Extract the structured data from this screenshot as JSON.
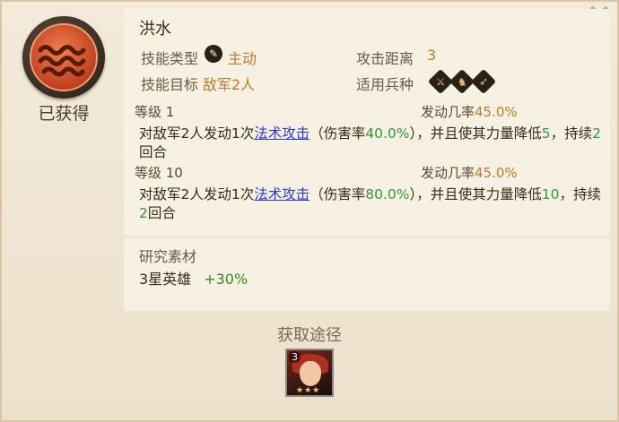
{
  "close_label": "×",
  "status": "已获得",
  "skill": {
    "name": "洪水",
    "type_label": "技能类型",
    "type_value": "主动",
    "target_label": "技能目标",
    "target_value": "敌军2人",
    "range_label": "攻击距离",
    "range_value": "3",
    "units_label": "适用兵种",
    "unit_icons": [
      "sword-icon",
      "horse-icon",
      "bow-icon"
    ]
  },
  "levels": [
    {
      "level_label": "等级 1",
      "rate_label": "发动几率",
      "rate_value": "45.0%",
      "d1": "对敌军2人发动1次",
      "link": "法术攻击",
      "d2": "（伤害率",
      "v1": "40.0%",
      "d3": "），并且使其力量降低",
      "v2": "5",
      "d4": "，持续",
      "v3": "2",
      "d5": "回合"
    },
    {
      "level_label": "等级 10",
      "rate_label": "发动几率",
      "rate_value": "45.0%",
      "d1": "对敌军2人发动1次",
      "link": "法术攻击",
      "d2": "（伤害率",
      "v1": "80.0%",
      "d3": "），并且使其力量降低",
      "v2": "10",
      "d4": "，持续",
      "v3": "2",
      "d5": "回合"
    }
  ],
  "materials": {
    "title": "研究素材",
    "item": "3星英雄",
    "bonus": "+30%"
  },
  "source": {
    "title": "获取途径",
    "hero_level": "3",
    "hero_stars": "★★★"
  },
  "colors": {
    "accent_value": "#c07a28",
    "highlight_green": "#2e9a3e",
    "link_blue": "#2a3ae0"
  }
}
